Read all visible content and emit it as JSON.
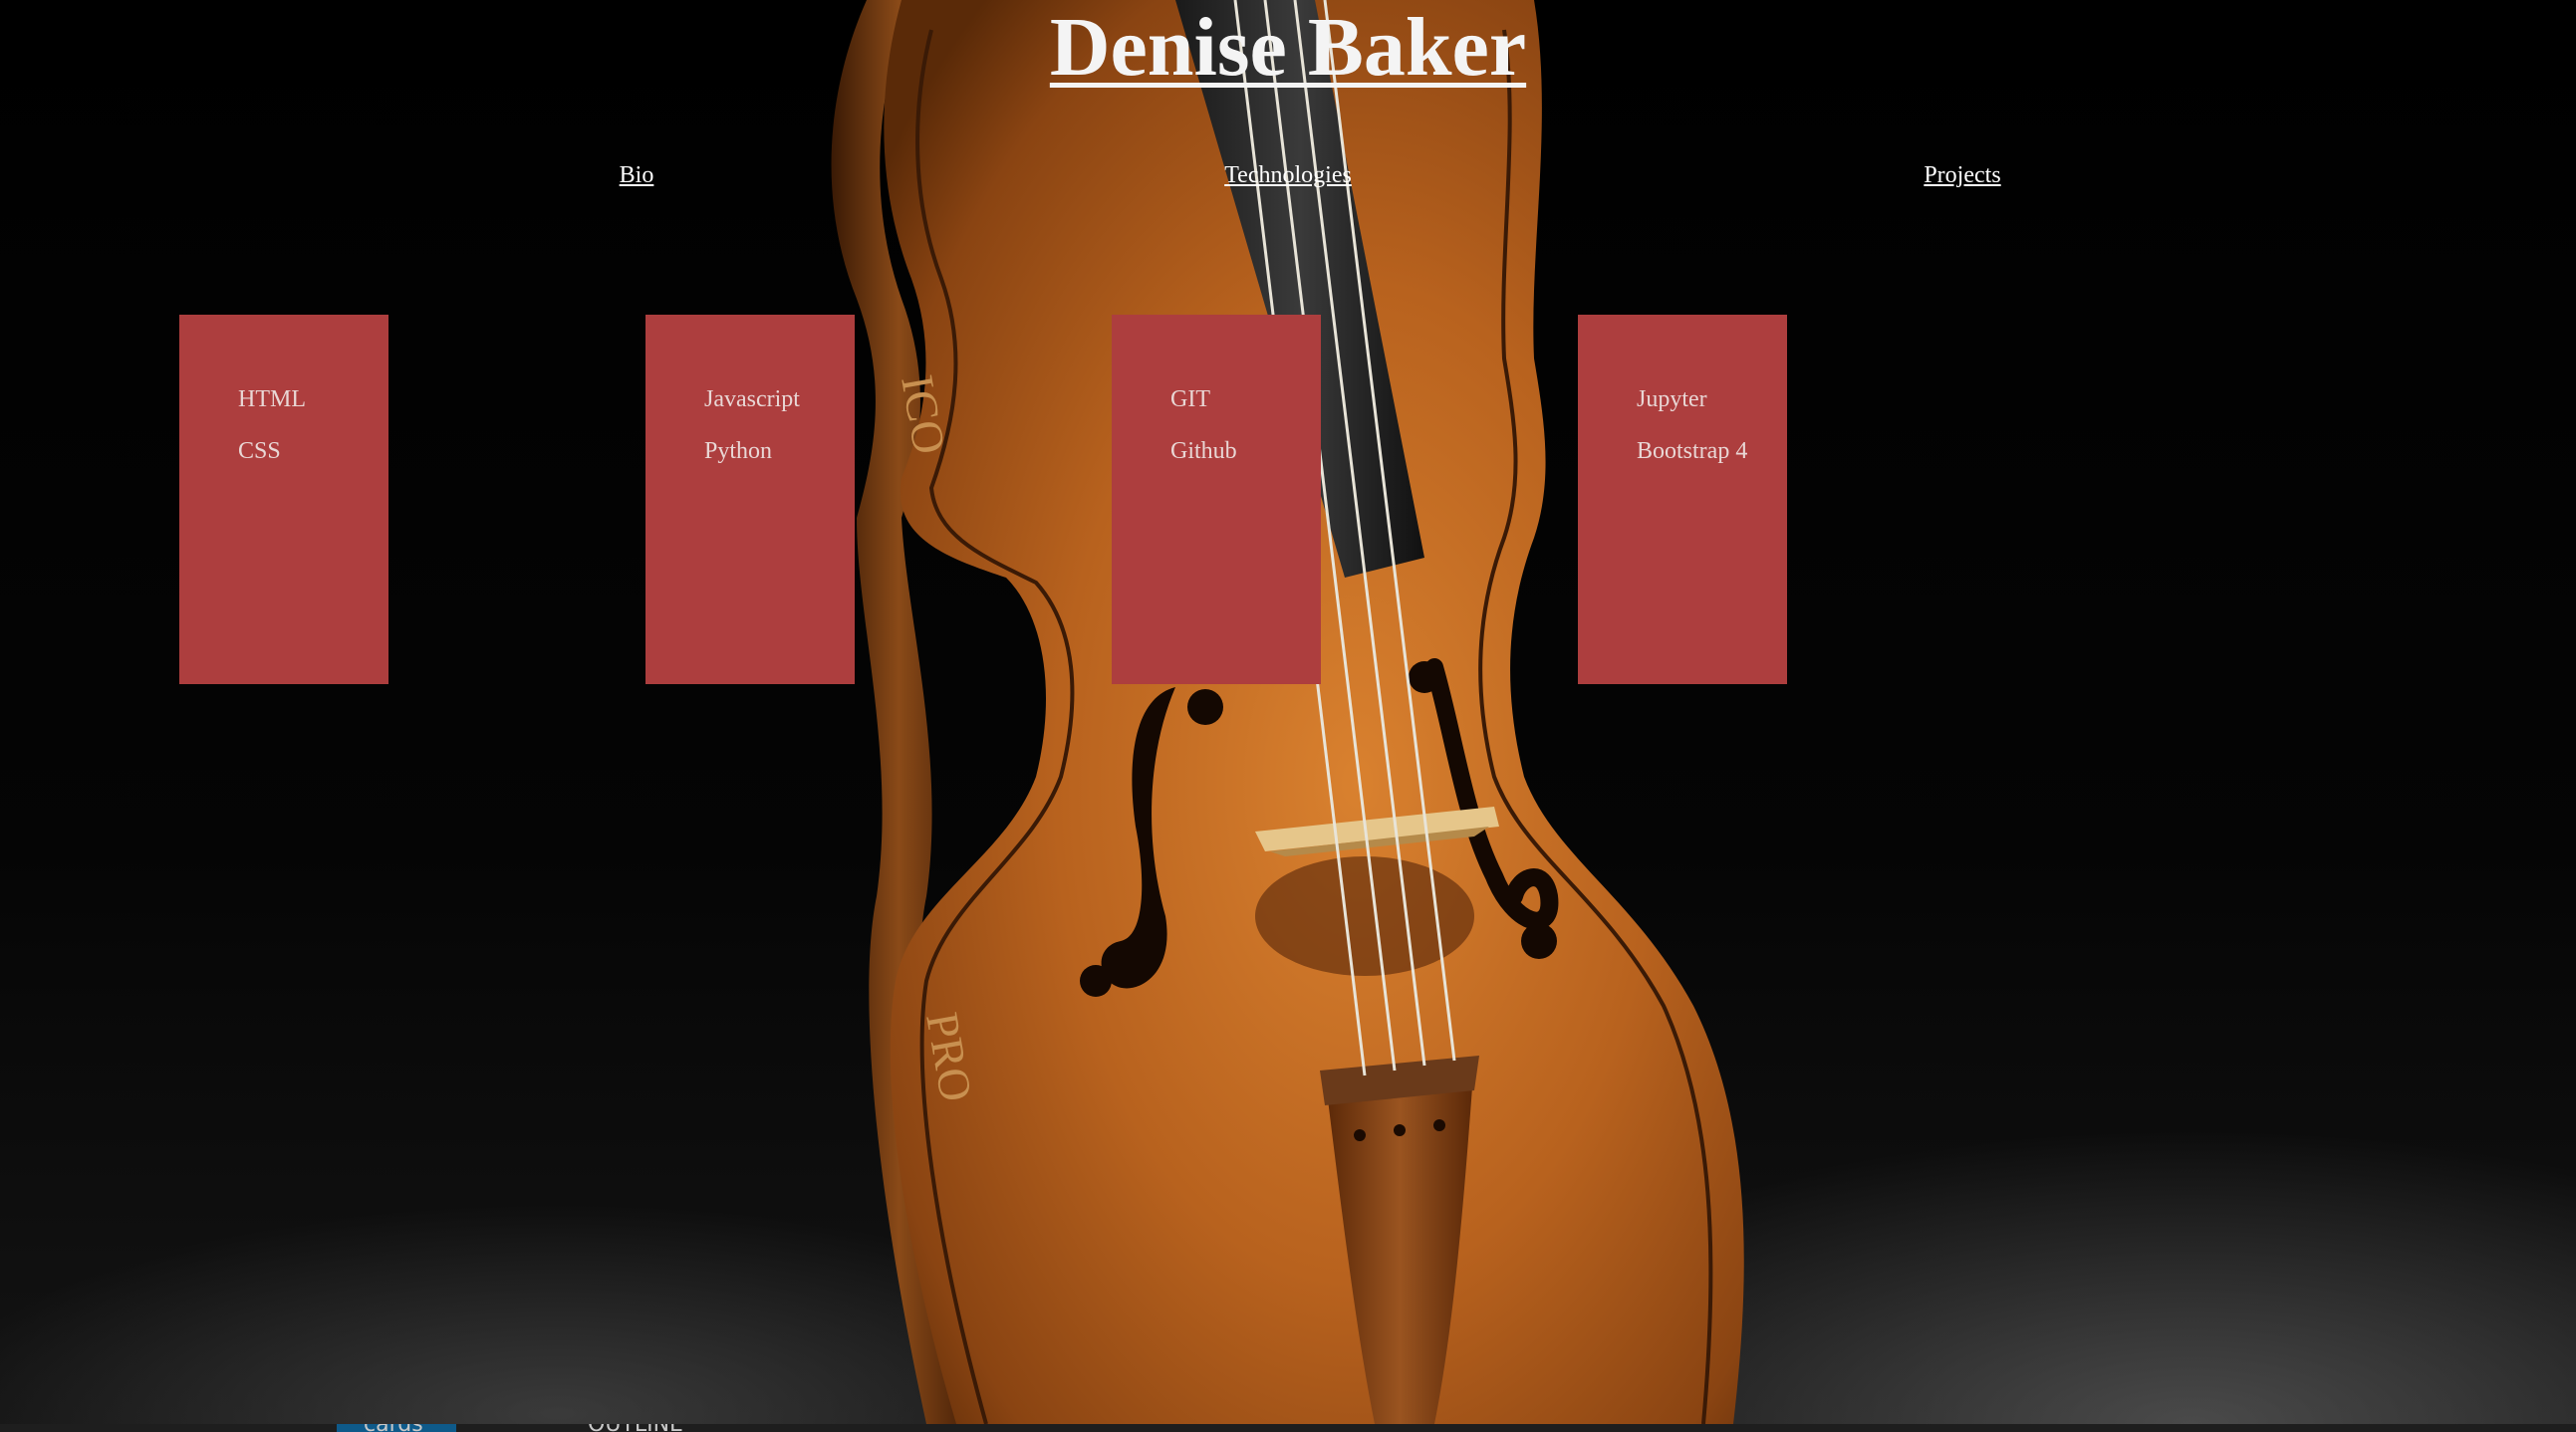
{
  "header": {
    "title": "Denise Baker"
  },
  "nav": {
    "items": [
      {
        "label": "Bio"
      },
      {
        "label": "Technologies"
      },
      {
        "label": "Projects"
      }
    ]
  },
  "cards": [
    {
      "items": [
        "HTML",
        "CSS"
      ]
    },
    {
      "items": [
        "Javascript",
        "Python"
      ]
    },
    {
      "items": [
        "GIT",
        "Github"
      ]
    },
    {
      "items": [
        "Jupyter",
        "Bootstrap 4"
      ]
    }
  ],
  "colors": {
    "background": "#000000",
    "card": "#ad3e3e",
    "card_text": "#e9d7d5",
    "link": "#ffffff",
    "violin_wood": "#b5621f"
  },
  "background_image": "violin",
  "taskbar": {
    "items": [
      "cards",
      "OUTLINE"
    ]
  }
}
